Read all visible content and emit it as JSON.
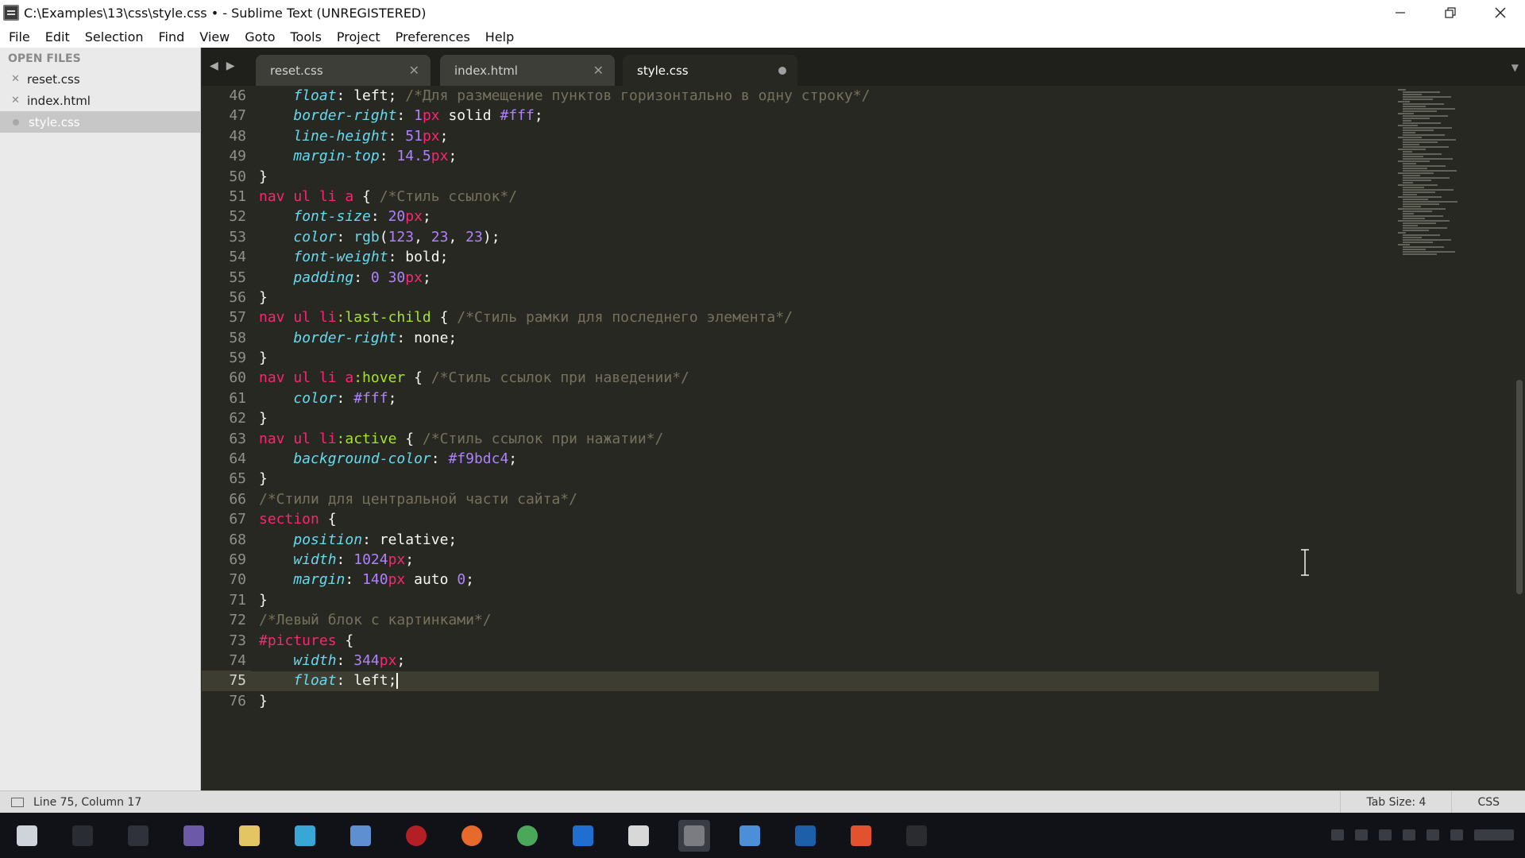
{
  "window": {
    "title": "C:\\Examples\\13\\css\\style.css • - Sublime Text (UNREGISTERED)",
    "controls": [
      "minimize",
      "restore",
      "close"
    ]
  },
  "menu": [
    "File",
    "Edit",
    "Selection",
    "Find",
    "View",
    "Goto",
    "Tools",
    "Project",
    "Preferences",
    "Help"
  ],
  "sidebar": {
    "heading": "OPEN FILES",
    "files": [
      {
        "name": "reset.css",
        "active": false
      },
      {
        "name": "index.html",
        "active": false
      },
      {
        "name": "style.css",
        "active": true
      }
    ]
  },
  "tabs": [
    {
      "label": "reset.css",
      "active": false
    },
    {
      "label": "index.html",
      "active": false
    },
    {
      "label": "style.css",
      "active": true,
      "dirty": true
    }
  ],
  "editor": {
    "line_numbers": [
      "46",
      "47",
      "48",
      "49",
      "50",
      "51",
      "52",
      "53",
      "54",
      "55",
      "56",
      "57",
      "58",
      "59",
      "60",
      "61",
      "62",
      "63",
      "64",
      "65",
      "66",
      "67",
      "68",
      "69",
      "70",
      "71",
      "72",
      "73",
      "74",
      "75",
      "76"
    ],
    "current_line": "75",
    "lines": [
      "    float: left; /*Для размещение пунктов горизонтально в одну строку*/",
      "    border-right: 1px solid #fff;",
      "    line-height: 51px;",
      "    margin-top: 14.5px;",
      "}",
      "nav ul li a { /*Стиль ссылок*/",
      "    font-size: 20px;",
      "    color: rgb(123, 23, 23);",
      "    font-weight: bold;",
      "    padding: 0 30px;",
      "}",
      "nav ul li:last-child { /*Стиль рамки для последнего элемента*/",
      "    border-right: none;",
      "}",
      "nav ul li a:hover { /*Стиль ссылок при наведении*/",
      "    color: #fff;",
      "}",
      "nav ul li:active { /*Стиль ссылок при нажатии*/",
      "    background-color: #f9bdc4;",
      "}",
      "/*Стили для центральной части сайта*/",
      "section {",
      "    position: relative;",
      "    width: 1024px;",
      "    margin: 140px auto 0;",
      "}",
      "/*Левый блок с картинками*/",
      "#pictures {",
      "    width: 344px;",
      "    float: left;",
      "}"
    ]
  },
  "status": {
    "position": "Line 75, Column 17",
    "tab_size": "Tab Size: 4",
    "syntax": "CSS"
  },
  "theme": {
    "background": "#272822",
    "selector": "#f92672",
    "property": "#66d9ef",
    "number": "#ae81ff",
    "pseudo": "#a6e22e",
    "comment": "#75715e"
  }
}
